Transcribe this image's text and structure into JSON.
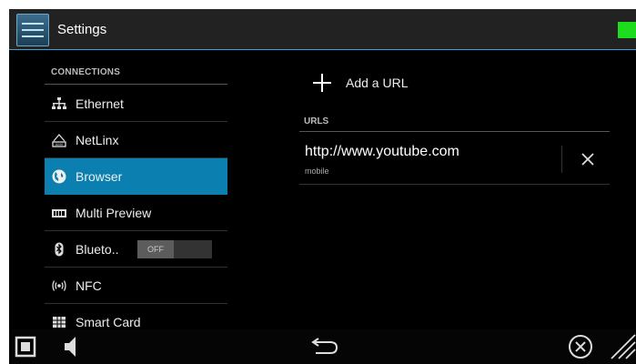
{
  "app": {
    "title": "Settings"
  },
  "sidebar": {
    "section_header": "CONNECTIONS",
    "items": [
      {
        "label": "Ethernet",
        "icon": "ethernet-icon"
      },
      {
        "label": "NetLinx",
        "icon": "netlinx-icon"
      },
      {
        "label": "Browser",
        "icon": "browser-globe-icon",
        "selected": true
      },
      {
        "label": "Multi Preview",
        "icon": "multi-preview-icon"
      },
      {
        "label": "Blueto..",
        "icon": "bluetooth-icon",
        "toggle": "OFF"
      },
      {
        "label": "NFC",
        "icon": "nfc-icon"
      },
      {
        "label": "Smart Card",
        "icon": "smart-card-icon"
      }
    ]
  },
  "main": {
    "add_url_label": "Add a URL",
    "urls_header": "URLS",
    "urls": [
      {
        "url": "http://www.youtube.com",
        "sub": "mobile"
      }
    ]
  },
  "colors": {
    "accent": "#0b7fb0",
    "status": "#1ddb1d",
    "divider": "#2fa7dc"
  }
}
